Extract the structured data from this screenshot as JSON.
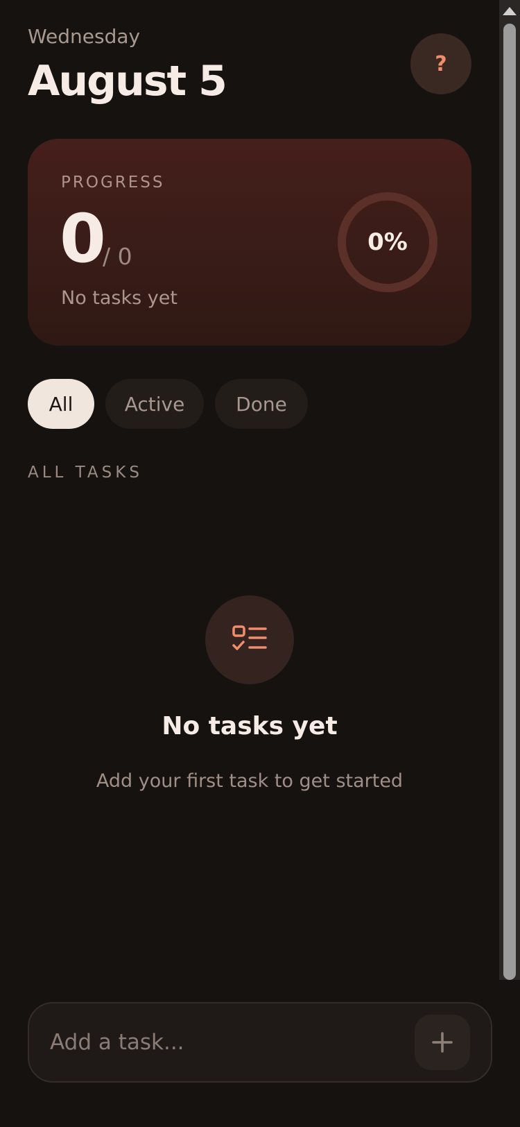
{
  "header": {
    "weekday": "Wednesday",
    "date": "August 5",
    "help_label": "?"
  },
  "progress": {
    "label": "PROGRESS",
    "completed": "0",
    "total": "/ 0",
    "subtitle": "No tasks yet",
    "percent_label": "0%",
    "percent_value": 0
  },
  "filters": [
    {
      "label": "All",
      "selected": true
    },
    {
      "label": "Active",
      "selected": false
    },
    {
      "label": "Done",
      "selected": false
    }
  ],
  "section_title": "ALL TASKS",
  "empty_state": {
    "icon": "task-list-icon",
    "title": "No tasks yet",
    "subtitle": "Add your first task to get started"
  },
  "composer": {
    "placeholder": "Add a task...",
    "add_icon": "plus-icon"
  },
  "colors": {
    "background": "#151210",
    "accent": "#f08d6c",
    "card": "#3d1e1a",
    "pill_selected": "#f1e6dd"
  }
}
